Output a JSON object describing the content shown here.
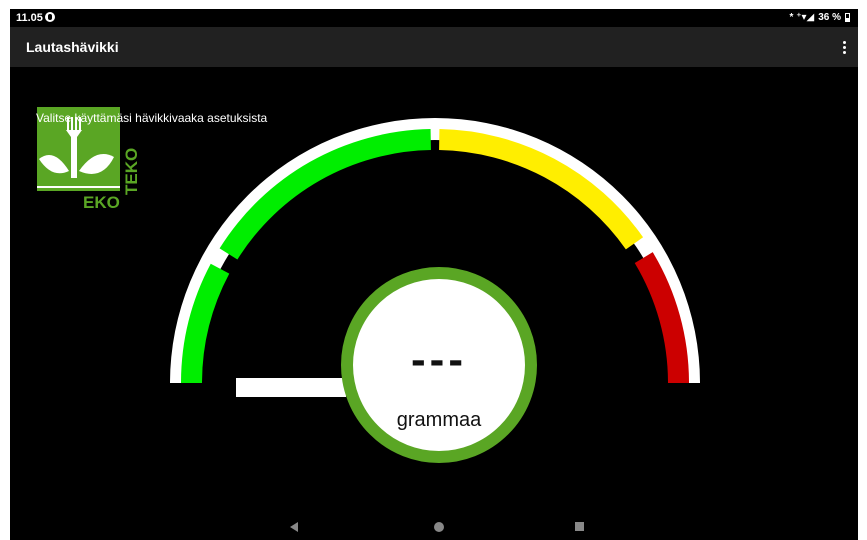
{
  "status": {
    "time": "11.05",
    "signal_text": "* ⁺▾◢",
    "battery_percent": "36 %"
  },
  "app_bar": {
    "title": "Lautashävikki",
    "menu_icon": "more-vert-icon"
  },
  "logo": {
    "text_bottom": "EKO",
    "text_side": "TEKO",
    "color": "#5aa624"
  },
  "hint": "Valitse käyttämäsi hävikkivaaka asetuksista",
  "gauge": {
    "segments": [
      {
        "name": "green-low",
        "color": "#00ee00"
      },
      {
        "name": "green-high",
        "color": "#00ee00"
      },
      {
        "name": "yellow",
        "color": "#ffee00"
      },
      {
        "name": "red",
        "color": "#cc0000"
      }
    ],
    "value_display": "---",
    "unit": "grammaa",
    "ring_color": "#5aa624"
  },
  "nav": {
    "back_icon": "back-triangle-icon",
    "home_icon": "home-circle-icon",
    "recents_icon": "recents-square-icon"
  }
}
